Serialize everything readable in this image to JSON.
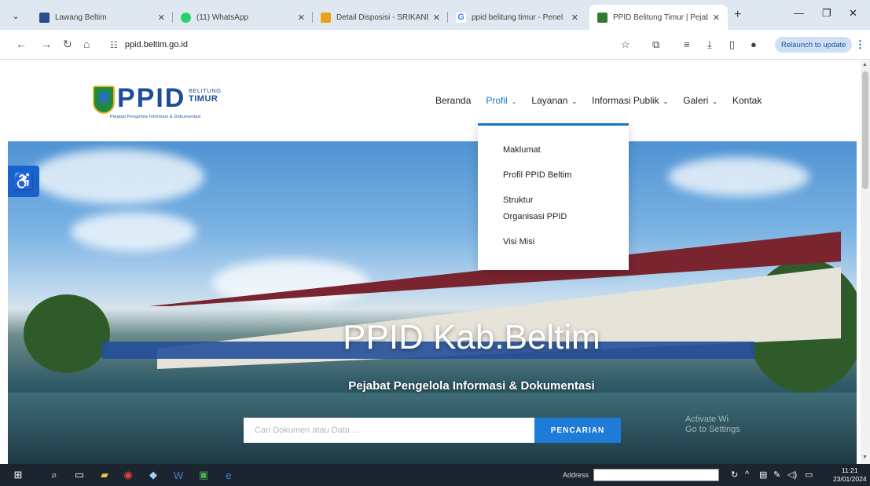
{
  "browser": {
    "tabs": [
      {
        "title": "Lawang Beltim",
        "favicon_color": "#2a4d8f"
      },
      {
        "title": "(11) WhatsApp",
        "favicon_color": "#25d366"
      },
      {
        "title": "Detail Disposisi - SRIKANDI",
        "favicon_color": "#e8a317"
      },
      {
        "title": "ppid belitung timur - Penel",
        "favicon_color": "#4285f4"
      },
      {
        "title": "PPID Belitung Timur | Pejab",
        "favicon_color": "#2e7d32"
      }
    ],
    "url": "ppid.beltim.go.id",
    "relaunch_label": "Relaunch to update"
  },
  "site": {
    "logo_text": "PPID",
    "logo_sub1": "BELITUNG",
    "logo_sub2": "TIMUR",
    "logo_tagline": "Pejabat Pengelola Informasi & Dokumentasi",
    "nav": [
      {
        "label": "Beranda",
        "caret": ""
      },
      {
        "label": "Profil",
        "caret": "⌄"
      },
      {
        "label": "Layanan",
        "caret": "⌄"
      },
      {
        "label": "Informasi Publik",
        "caret": "⌄"
      },
      {
        "label": "Galeri",
        "caret": "⌄"
      },
      {
        "label": "Kontak",
        "caret": ""
      }
    ],
    "dropdown": [
      "Maklumat",
      "Profil PPID Beltim",
      "Struktur Organisasi PPID",
      "Visi Misi"
    ],
    "hero_title": "PPID Kab.Beltim",
    "hero_subtitle": "Pejabat Pengelola Informasi & Dokumentasi",
    "search_placeholder": "Cari Dokumen atau Data ...",
    "search_button": "PENCARIAN",
    "watermark_line1": "Activate Wi",
    "watermark_line2": "Go to Settings"
  },
  "taskbar": {
    "address_label": "Address",
    "time": "11:21",
    "date": "23/01/2024"
  }
}
